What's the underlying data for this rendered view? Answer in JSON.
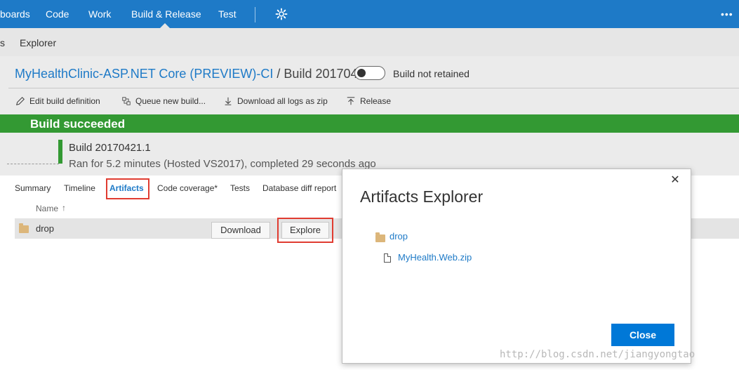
{
  "topnav": {
    "items": [
      "boards",
      "Code",
      "Work",
      "Build & Release",
      "Test"
    ],
    "more_icon": "ellipsis-icon",
    "settings_icon": "gear-icon"
  },
  "subnav": {
    "items": [
      "s",
      "Explorer"
    ]
  },
  "build": {
    "definition_link": "MyHealthClinic-ASP.NET Core (PREVIEW)-CI",
    "title_rest": " / Build 20170421.1",
    "retained_label": "Build not retained",
    "status_banner": "Build succeeded",
    "build_number": "Build 20170421.1",
    "run_info": "Ran for 5.2 minutes (Hosted VS2017), completed 29 seconds ago",
    "status_color": "#339933"
  },
  "toolbar": {
    "edit": "Edit build definition",
    "queue": "Queue new build...",
    "download_logs": "Download all logs as zip",
    "release": "Release"
  },
  "tabs": {
    "summary": "Summary",
    "timeline": "Timeline",
    "artifacts": "Artifacts",
    "code_coverage": "Code coverage*",
    "tests": "Tests",
    "db_diff": "Database diff report"
  },
  "artifacts_table": {
    "header": "Name",
    "rows": [
      {
        "name": "drop",
        "download_label": "Download",
        "explore_label": "Explore"
      }
    ]
  },
  "dialog": {
    "title": "Artifacts Explorer",
    "folder": "drop",
    "file": "MyHealth.Web.zip",
    "close_label": "Close",
    "close_x": "✕"
  },
  "watermark": "http://blog.csdn.net/jiangyongtao",
  "colors": {
    "nav": "#1e7ac7",
    "accent": "#0078d7",
    "highlight": "#e03c31"
  }
}
